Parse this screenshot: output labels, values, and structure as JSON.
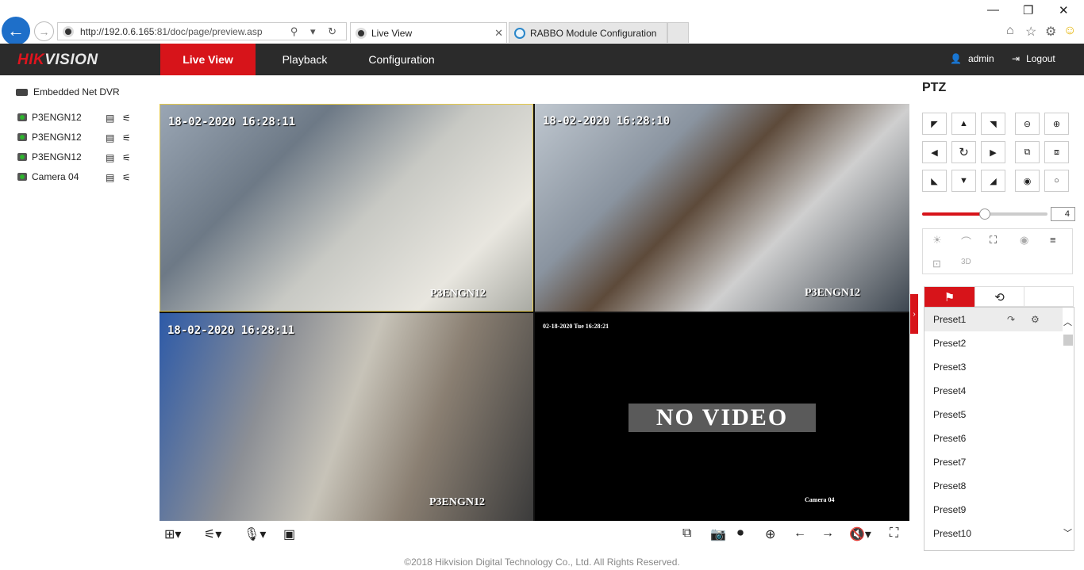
{
  "browser": {
    "url_host": "http://192.0.6.165",
    "url_rest": ":81/doc/page/preview.asp",
    "tabs": [
      {
        "label": "Live View",
        "active": true
      },
      {
        "label": "RABBO Module Configuration",
        "active": false
      }
    ]
  },
  "app": {
    "logo_a": "HIK",
    "logo_b": "VISION",
    "nav": [
      "Live View",
      "Playback",
      "Configuration"
    ],
    "active_nav": "Live View",
    "user": "admin",
    "logout": "Logout",
    "accent": "#d7141a"
  },
  "tree": {
    "root": "Embedded Net DVR",
    "cameras": [
      "P3ENGN12",
      "P3ENGN12",
      "P3ENGN12",
      "Camera 04"
    ]
  },
  "video": {
    "tiles": [
      {
        "timestamp": "18-02-2020 16:28:11",
        "name": "P3ENGN12"
      },
      {
        "timestamp": "18-02-2020 16:28:10",
        "name": "P3ENGN12"
      },
      {
        "timestamp": "18-02-2020 16:28:11",
        "name": "P3ENGN12"
      },
      {
        "timestamp": "02-18-2020 Tue 16:28:21",
        "name": "Camera 04",
        "message": "NO VIDEO"
      }
    ]
  },
  "ptz": {
    "title": "PTZ",
    "speed": "4",
    "speed_fraction": 0.5,
    "presets": [
      "Preset1",
      "Preset2",
      "Preset3",
      "Preset4",
      "Preset5",
      "Preset6",
      "Preset7",
      "Preset8",
      "Preset9",
      "Preset10"
    ]
  },
  "footer": "©2018 Hikvision Digital Technology Co., Ltd. All Rights Reserved."
}
